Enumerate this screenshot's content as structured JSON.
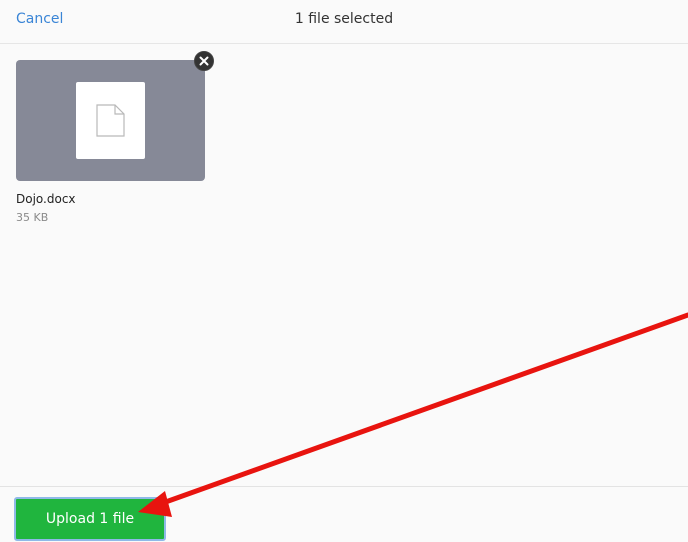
{
  "header": {
    "cancel_label": "Cancel",
    "title": "1 file selected"
  },
  "files": [
    {
      "name": "Dojo.docx",
      "size": "35 KB",
      "icon": "document-icon"
    }
  ],
  "footer": {
    "upload_label": "Upload 1 file"
  },
  "colors": {
    "accent": "#3a85d6",
    "upload_button": "#20b53e",
    "annotation_arrow": "#e8140f",
    "thumbnail_bg": "#868997"
  }
}
